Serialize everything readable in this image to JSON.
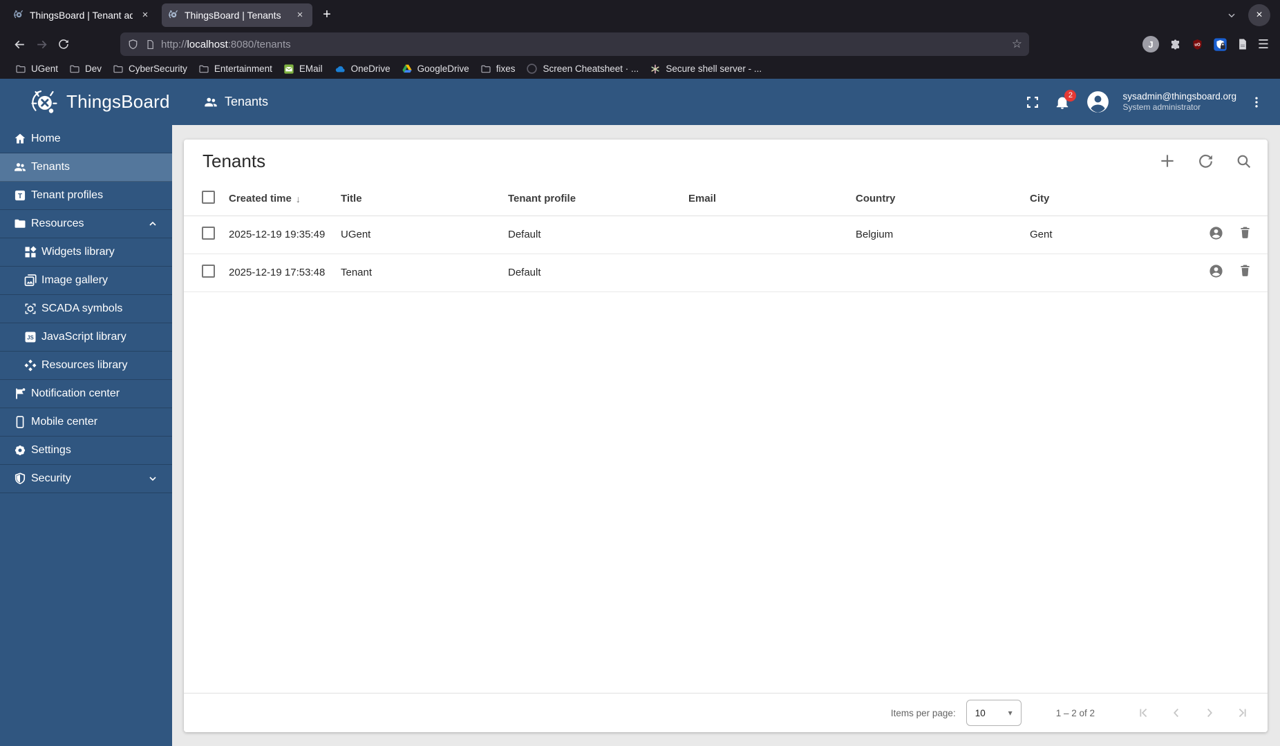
{
  "colors": {
    "header_blue": "#305680",
    "sidebar_active_blue": "#54779c",
    "badge_red": "#e53935",
    "browser_dark": "#1c1b22",
    "active_tab_gray": "#42414d",
    "ublock_red": "#7a0c0c",
    "bitwarden_blue": "#1a5fd0",
    "email_green": "#7fb241",
    "onedrive_blue": "#1b7fd4"
  },
  "browser": {
    "tabs": [
      {
        "title": "ThingsBoard | Tenant ad"
      },
      {
        "title": "ThingsBoard | Tenants"
      }
    ],
    "url": {
      "prefix": "http://",
      "host": "localhost",
      "rest": ":8080/tenants"
    },
    "bookmarks": [
      {
        "label": "UGent",
        "icon": "folder-icon"
      },
      {
        "label": "Dev",
        "icon": "folder-icon"
      },
      {
        "label": "CyberSecurity",
        "icon": "folder-icon"
      },
      {
        "label": "Entertainment",
        "icon": "folder-icon"
      },
      {
        "label": "EMail",
        "icon": "email-icon"
      },
      {
        "label": "OneDrive",
        "icon": "onedrive-cloud-icon"
      },
      {
        "label": "GoogleDrive",
        "icon": "google-drive-icon"
      },
      {
        "label": "fixes",
        "icon": "folder-icon"
      },
      {
        "label": "Screen Cheatsheet · ...",
        "icon": "github-circle-icon"
      },
      {
        "label": "Secure shell server - ...",
        "icon": "colorful-asterisk-icon"
      }
    ]
  },
  "header": {
    "app_name": "ThingsBoard",
    "page_title": "Tenants",
    "notification_count": "2",
    "user_email": "sysadmin@thingsboard.org",
    "user_role": "System administrator"
  },
  "sidebar": {
    "items": [
      {
        "label": "Home",
        "icon": "home-icon"
      },
      {
        "label": "Tenants",
        "icon": "people-icon"
      },
      {
        "label": "Tenant profiles",
        "icon": "tenant-profile-icon"
      },
      {
        "label": "Resources",
        "icon": "folder-icon"
      },
      {
        "label": "Widgets library",
        "icon": "widgets-icon"
      },
      {
        "label": "Image gallery",
        "icon": "image-gallery-icon"
      },
      {
        "label": "SCADA symbols",
        "icon": "scada-icon"
      },
      {
        "label": "JavaScript library",
        "icon": "javascript-icon"
      },
      {
        "label": "Resources library",
        "icon": "resources-library-icon"
      },
      {
        "label": "Notification center",
        "icon": "notification-flag-icon"
      },
      {
        "label": "Mobile center",
        "icon": "mobile-icon"
      },
      {
        "label": "Settings",
        "icon": "gear-icon"
      },
      {
        "label": "Security",
        "icon": "shield-icon"
      }
    ]
  },
  "main": {
    "card_title": "Tenants",
    "table": {
      "columns": [
        "Created time",
        "Title",
        "Tenant profile",
        "Email",
        "Country",
        "City"
      ],
      "rows": [
        {
          "created_time": "2025-12-19 19:35:49",
          "title": "UGent",
          "tenant_profile": "Default",
          "email": "",
          "country": "Belgium",
          "city": "Gent"
        },
        {
          "created_time": "2025-12-19 17:53:48",
          "title": "Tenant",
          "tenant_profile": "Default",
          "email": "",
          "country": "",
          "city": ""
        }
      ]
    },
    "pagination": {
      "items_per_page_label": "Items per page:",
      "page_size": "10",
      "range_label": "1 – 2 of 2"
    }
  },
  "glyphs": {
    "close": "×",
    "plus": "+",
    "menu": "☰",
    "star": "☆",
    "sort_desc": "↓",
    "dropdown": "▾"
  }
}
